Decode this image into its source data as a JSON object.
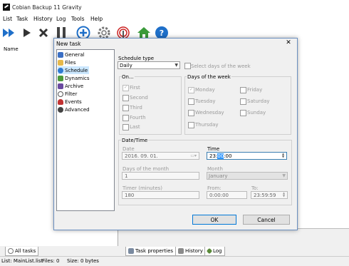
{
  "app": {
    "title": "Cobian Backup 11 Gravity"
  },
  "menu": [
    "List",
    "Task",
    "History",
    "Log",
    "Tools",
    "Help"
  ],
  "left_panel": {
    "header": "Name"
  },
  "bottom_tabs": {
    "all_tasks": "All tasks",
    "task_properties": "Task properties",
    "history": "History",
    "log": "Log"
  },
  "status": {
    "list": "List: MainList.list",
    "files": "Files: 0",
    "size": "Size: 0 bytes"
  },
  "dialog": {
    "title": "New task",
    "close": "✕",
    "tree": [
      {
        "label": "General",
        "icon": "general-icon",
        "color": "#3b6fc4"
      },
      {
        "label": "Files",
        "icon": "files-icon",
        "color": "#e6b84a"
      },
      {
        "label": "Schedule",
        "icon": "schedule-icon",
        "color": "#2f7ad1"
      },
      {
        "label": "Dynamics",
        "icon": "dynamics-icon",
        "color": "#4c9a3a"
      },
      {
        "label": "Archive",
        "icon": "archive-icon",
        "color": "#6a4aa0"
      },
      {
        "label": "Filter",
        "icon": "filter-icon",
        "color": "#555555"
      },
      {
        "label": "Events",
        "icon": "events-icon",
        "color": "#c23232"
      },
      {
        "label": "Advanced",
        "icon": "advanced-icon",
        "color": "#444444"
      }
    ],
    "schedule_type_label": "Schedule type",
    "schedule_type_value": "Daily",
    "select_days_label": "Select days of the week",
    "on_group": {
      "label": "On...",
      "items": [
        "First",
        "Second",
        "Third",
        "Fourth",
        "Last"
      ]
    },
    "days_group": {
      "label": "Days of the week",
      "col1": [
        "Monday",
        "Tuesday",
        "Wednesday",
        "Thursday"
      ],
      "col2": [
        "Friday",
        "Saturday",
        "Sunday"
      ]
    },
    "datetime": {
      "label": "Date/Time",
      "date_label": "Date",
      "date_value": "2016. 09. 01.",
      "time_label": "Time",
      "time_value_pre": "23:",
      "time_value_sel": "00",
      "time_value_post": ":00",
      "days_of_month_label": "Days of the month",
      "days_of_month_value": "1",
      "month_label": "Month",
      "month_value": "January",
      "timer_label": "Timer (minutes)",
      "timer_value": "180",
      "from_label": "From:",
      "from_value": "0:00:00",
      "to_label": "To:",
      "to_value": "23:59:59"
    },
    "ok": "OK",
    "cancel": "Cancel"
  }
}
